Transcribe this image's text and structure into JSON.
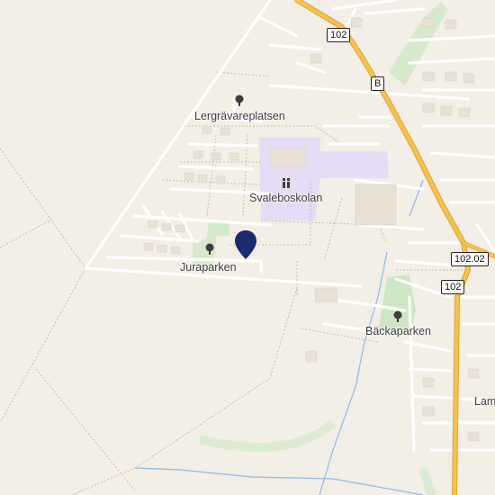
{
  "map": {
    "places": {
      "lergravareplatsen": "Lergrävareplatsen",
      "svaleboskolan": "Svaleboskolan",
      "juraparken": "Juraparken",
      "backaparken": "Bäckaparken",
      "lam_partial": "Lam"
    },
    "road_shields": {
      "r102_top": "102",
      "rB": "B",
      "r102_02": "102.02",
      "r102_bottom": "102"
    },
    "icons": {
      "park": "tree-icon",
      "school": "school-icon",
      "location": "location-pin-icon"
    },
    "colors": {
      "background": "#f3efe7",
      "main_road": "#f5c34c",
      "school_area": "#e6dcf5",
      "park_area": "#cfe6c4",
      "pin": "#1a2a6c",
      "water": "#8fb8e6"
    }
  }
}
